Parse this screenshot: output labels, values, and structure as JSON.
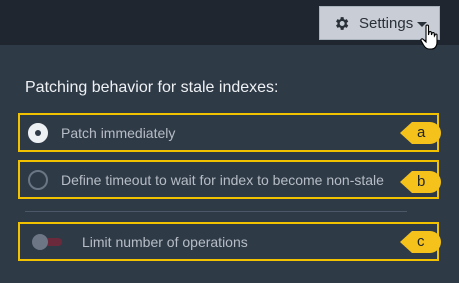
{
  "header": {
    "settings_label": "Settings",
    "settings_icon": "gear-icon",
    "dropdown_icon": "caret-down-icon"
  },
  "section": {
    "heading": "Patching behavior for stale indexes:"
  },
  "options": [
    {
      "label": "Patch immediately",
      "selected": true,
      "callout": "a"
    },
    {
      "label": "Define timeout to wait for index to become non-stale",
      "selected": false,
      "callout": "b"
    }
  ],
  "limit": {
    "label": "Limit number of operations",
    "enabled": false,
    "callout": "c"
  },
  "colors": {
    "highlight": "#f2c200",
    "background": "#2f3a47",
    "topbar": "#1f262f"
  }
}
